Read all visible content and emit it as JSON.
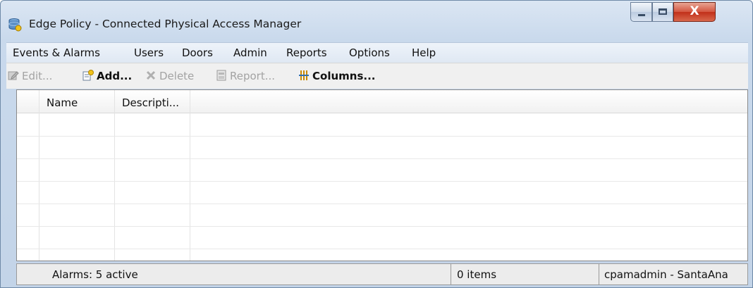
{
  "window": {
    "title": "Edge Policy - Connected Physical Access Manager",
    "app_icon": "database-icon",
    "controls": {
      "minimize_icon": "minimize-icon",
      "maximize_icon": "maximize-icon",
      "close_icon": "close-icon",
      "close_glyph": "X"
    }
  },
  "menu": {
    "items": [
      {
        "label": "Events & Alarms"
      },
      {
        "label": "Users"
      },
      {
        "label": "Doors"
      },
      {
        "label": "Admin"
      },
      {
        "label": "Reports"
      },
      {
        "label": "Options"
      },
      {
        "label": "Help"
      }
    ]
  },
  "toolbar": {
    "edit_label": "Edit...",
    "add_label": "Add...",
    "delete_label": "Delete",
    "report_label": "Report...",
    "columns_label": "Columns..."
  },
  "table": {
    "columns": [
      {
        "label": "Name"
      },
      {
        "label": "Descripti..."
      }
    ],
    "rows": []
  },
  "status": {
    "alarms": "Alarms: 5 active",
    "items": "0 items",
    "user": "cpamadmin - SantaAna"
  },
  "colors": {
    "accent": "#c3d4e8",
    "close_button": "#c1301a",
    "disabled_text": "#a3a3a3"
  }
}
